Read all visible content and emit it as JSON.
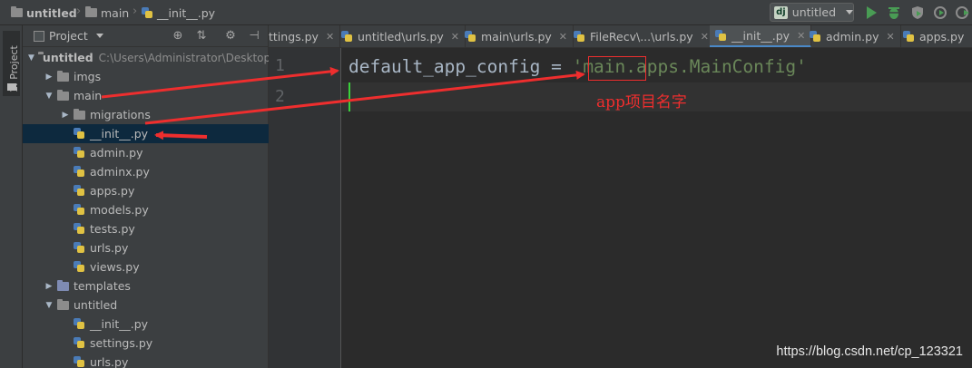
{
  "navbar": {
    "crumbs": [
      "untitled",
      "main",
      "__init__.py"
    ],
    "run_config": "untitled"
  },
  "toolwindow": {
    "vertical_tab": "1: Project"
  },
  "project": {
    "header": "Project",
    "tree": [
      {
        "name": "untitled",
        "path": "C:\\Users\\Administrator\\Desktop",
        "kind": "folder",
        "depth": 0,
        "expanded": true
      },
      {
        "name": "imgs",
        "kind": "folder",
        "depth": 1,
        "expanded": false
      },
      {
        "name": "main",
        "kind": "folder",
        "depth": 1,
        "expanded": true
      },
      {
        "name": "migrations",
        "kind": "folder",
        "depth": 2,
        "expanded": false
      },
      {
        "name": "__init__.py",
        "kind": "py",
        "depth": 2,
        "selected": true
      },
      {
        "name": "admin.py",
        "kind": "py",
        "depth": 2
      },
      {
        "name": "adminx.py",
        "kind": "py",
        "depth": 2
      },
      {
        "name": "apps.py",
        "kind": "py",
        "depth": 2
      },
      {
        "name": "models.py",
        "kind": "py",
        "depth": 2
      },
      {
        "name": "tests.py",
        "kind": "py",
        "depth": 2
      },
      {
        "name": "urls.py",
        "kind": "py",
        "depth": 2
      },
      {
        "name": "views.py",
        "kind": "py",
        "depth": 2
      },
      {
        "name": "templates",
        "kind": "template",
        "depth": 1,
        "expanded": false
      },
      {
        "name": "untitled",
        "kind": "folder",
        "depth": 1,
        "expanded": true
      },
      {
        "name": "__init__.py",
        "kind": "py",
        "depth": 2
      },
      {
        "name": "settings.py",
        "kind": "py",
        "depth": 2
      },
      {
        "name": "urls.py",
        "kind": "py",
        "depth": 2
      }
    ]
  },
  "tabs": [
    {
      "label": "ttings.py",
      "active": false
    },
    {
      "label": "untitled\\urls.py",
      "active": false
    },
    {
      "label": "main\\urls.py",
      "active": false
    },
    {
      "label": "FileRecv\\...\\urls.py",
      "active": false
    },
    {
      "label": "__init__.py",
      "active": true
    },
    {
      "label": "admin.py",
      "active": false
    },
    {
      "label": "apps.py",
      "active": false
    }
  ],
  "editor": {
    "line_numbers": [
      "1",
      "2"
    ],
    "code": {
      "ident": "default_app_config",
      "op": " = ",
      "quote_open": "'",
      "str_highlight": "main",
      "str_rest": ".apps.MainConfig",
      "quote_close": "'"
    }
  },
  "annotation": "app项目名字",
  "watermark": "https://blog.csdn.net/cp_123321",
  "colors": {
    "annotation_red": "#ee2e2e",
    "string_green": "#6a8759",
    "caret_green": "#3bd13b",
    "selection": "#0d293e"
  }
}
